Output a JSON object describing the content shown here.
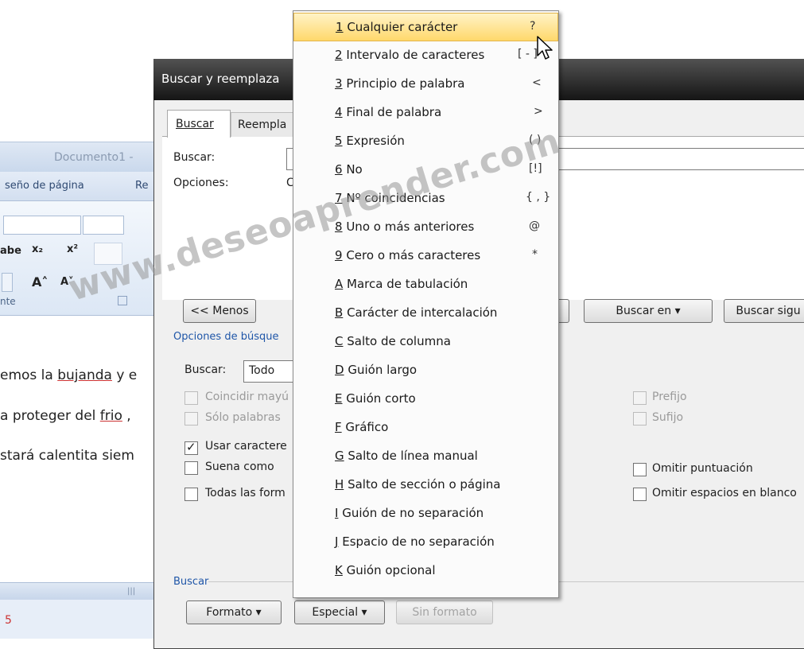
{
  "word": {
    "title": "Documento1 -",
    "tab_design": "seño de página",
    "tab_ref": "Re",
    "group_label": "nte",
    "doc_lines": [
      {
        "before": "emos la ",
        "underlined": "bujanda",
        "after": " y e"
      },
      {
        "before": "a proteger del ",
        "underlined": "frio",
        "after": " ,"
      },
      {
        "before": "stará calentita siem",
        "underlined": "",
        "after": ""
      }
    ],
    "status_red": "5",
    "scroll_glyph": "|||"
  },
  "dialog": {
    "title": "Buscar y reemplaza",
    "tab_find": "Buscar",
    "tab_replace": "Reempla",
    "find_label": "Buscar:",
    "options_label": "Opciones:",
    "options_value": "C",
    "less_button": "<< Menos",
    "search_in_button": "Buscar en ▾",
    "find_next_button": "Buscar sigu",
    "options_header": "Opciones de búsque",
    "search_label": "Buscar:",
    "search_value": "Todo",
    "checkboxes_left": [
      {
        "label": "Coincidir mayú",
        "checked": false,
        "disabled": true
      },
      {
        "label": "Sólo palabras",
        "checked": false,
        "disabled": true
      },
      {
        "label": "Usar caractere",
        "checked": true,
        "disabled": false
      },
      {
        "label": "Suena como",
        "checked": false,
        "disabled": false
      },
      {
        "label": "Todas las form",
        "checked": false,
        "disabled": false
      }
    ],
    "checkboxes_right": [
      {
        "label": "Prefijo",
        "checked": false,
        "disabled": true
      },
      {
        "label": "Sufijo",
        "checked": false,
        "disabled": true
      },
      {
        "label": "Omitir puntuación",
        "checked": false,
        "disabled": false
      },
      {
        "label": "Omitir espacios en blanco",
        "checked": false,
        "disabled": false
      }
    ],
    "find_group_label": "Buscar",
    "format_button": "Formato ▾",
    "special_button": "Especial ▾",
    "no_format_button": "Sin formato"
  },
  "menu": {
    "items": [
      {
        "key": "1",
        "label": "Cualquier carácter",
        "shortcut": "?",
        "selected": true
      },
      {
        "key": "2",
        "label": "Intervalo de caracteres",
        "shortcut": "[ - ]"
      },
      {
        "key": "3",
        "label": "Principio de palabra",
        "shortcut": "<"
      },
      {
        "key": "4",
        "label": "Final de palabra",
        "shortcut": ">"
      },
      {
        "key": "5",
        "label": "Expresión",
        "shortcut": "( )"
      },
      {
        "key": "6",
        "label": "No",
        "shortcut": "[!]"
      },
      {
        "key": "7",
        "label": "Nº coincidencias",
        "shortcut": "{ , }"
      },
      {
        "key": "8",
        "label": "Uno o más anteriores",
        "shortcut": "@"
      },
      {
        "key": "9",
        "label": "Cero o más caracteres",
        "shortcut": "*"
      },
      {
        "key": "A",
        "label": "Marca de tabulación",
        "shortcut": ""
      },
      {
        "key": "B",
        "label": "Carácter de intercalación",
        "shortcut": ""
      },
      {
        "key": "C",
        "label": "Salto de columna",
        "shortcut": ""
      },
      {
        "key": "D",
        "label": "Guión largo",
        "shortcut": ""
      },
      {
        "key": "E",
        "label": "Guión corto",
        "shortcut": ""
      },
      {
        "key": "F",
        "label": "Gráfico",
        "shortcut": ""
      },
      {
        "key": "G",
        "label": "Salto de línea manual",
        "shortcut": ""
      },
      {
        "key": "H",
        "label": "Salto de sección o página",
        "shortcut": ""
      },
      {
        "key": "I",
        "label": "Guión de no separación",
        "shortcut": ""
      },
      {
        "key": "J",
        "label": "Espacio de no separación",
        "shortcut": ""
      },
      {
        "key": "K",
        "label": "Guión opcional",
        "shortcut": ""
      }
    ]
  },
  "watermark": "www.deseoaprender.com"
}
